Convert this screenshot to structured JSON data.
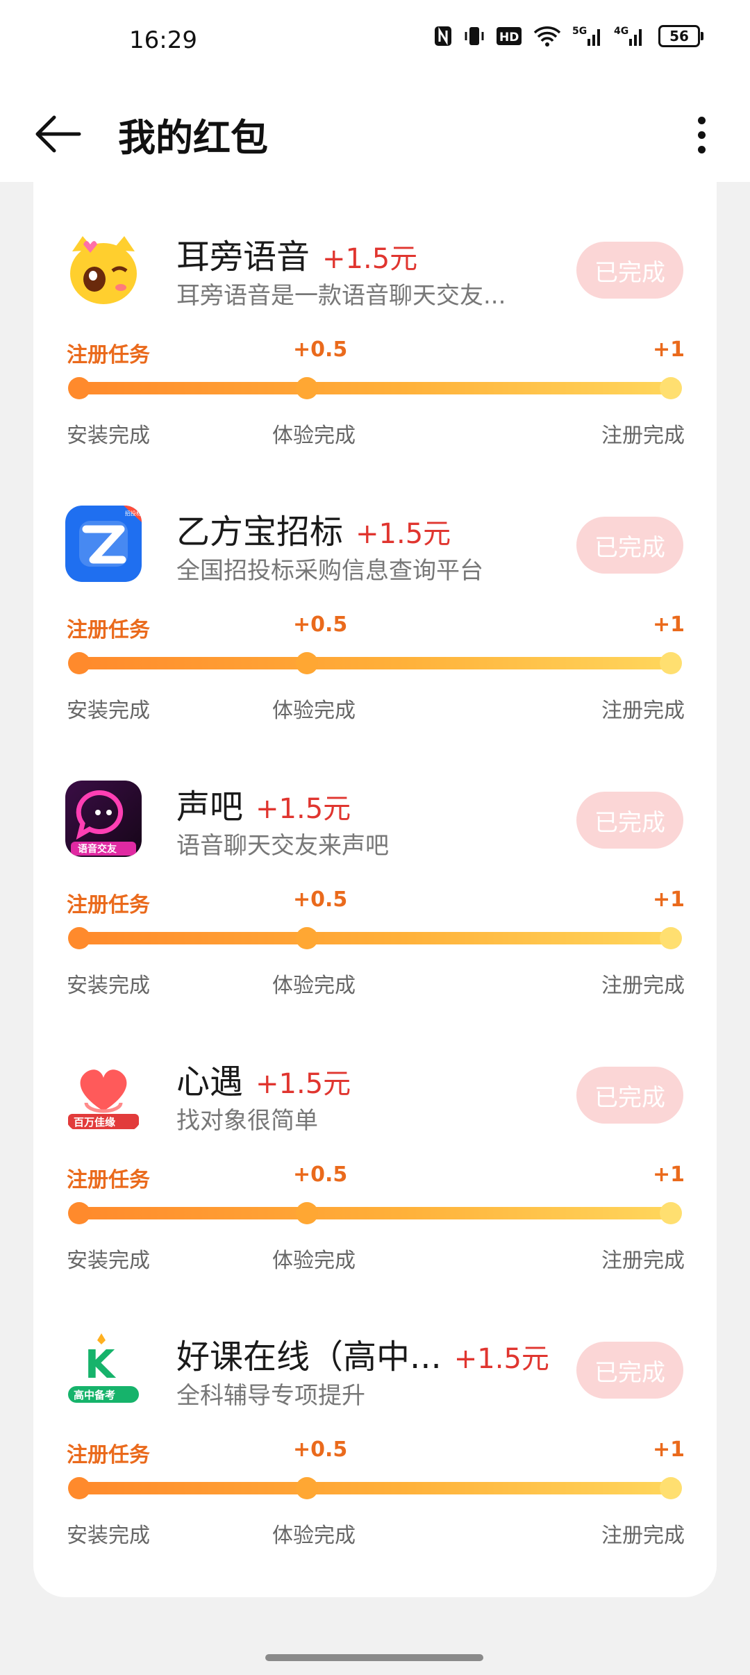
{
  "status": {
    "time": "16:29",
    "battery": "56",
    "hd": "HD",
    "net1": "5G",
    "net2": "4G"
  },
  "header": {
    "title": "我的红包"
  },
  "tasks": [
    {
      "name": "耳旁语音",
      "reward": "+1.5元",
      "desc": "耳旁语音是一款语音聊天交友...",
      "button": "已完成",
      "step_start": "注册任务",
      "step_mid": "+0.5",
      "step_end": "+1",
      "label_start": "安装完成",
      "label_mid": "体验完成",
      "label_end": "注册完成",
      "progress": 1.0,
      "icon": "cartoon-cat-icon",
      "color": "#ffcf2e"
    },
    {
      "name": "乙方宝招标",
      "reward": "+1.5元",
      "desc": "全国招投标采购信息查询平台",
      "button": "已完成",
      "step_start": "注册任务",
      "step_mid": "+0.5",
      "step_end": "+1",
      "label_start": "安装完成",
      "label_mid": "体验完成",
      "label_end": "注册完成",
      "progress": 1.0,
      "icon": "z-logo-icon",
      "color": "#1f6ff0"
    },
    {
      "name": "声吧",
      "reward": "+1.5元",
      "desc": "语音聊天交友来声吧",
      "button": "已完成",
      "step_start": "注册任务",
      "step_mid": "+0.5",
      "step_end": "+1",
      "label_start": "安装完成",
      "label_mid": "体验完成",
      "label_end": "注册完成",
      "progress": 1.0,
      "icon": "chat-bubble-icon",
      "color": "#7a1d6e"
    },
    {
      "name": "心遇",
      "reward": "+1.5元",
      "desc": "找对象很简单",
      "button": "已完成",
      "step_start": "注册任务",
      "step_mid": "+0.5",
      "step_end": "+1",
      "label_start": "安装完成",
      "label_mid": "体验完成",
      "label_end": "注册完成",
      "progress": 1.0,
      "icon": "heart-icon",
      "color": "#ff5a5a"
    },
    {
      "name": "好课在线（高中...",
      "reward": "+1.5元",
      "desc": "全科辅导专项提升",
      "button": "已完成",
      "step_start": "注册任务",
      "step_mid": "+0.5",
      "step_end": "+1",
      "label_start": "安装完成",
      "label_mid": "体验完成",
      "label_end": "注册完成",
      "progress": 1.0,
      "icon": "k-logo-icon",
      "color": "#16b36b"
    }
  ],
  "icon_texts": {
    "t2_badge": "招投标",
    "t3_caption": "语音交友",
    "t4_caption": "百万佳缘",
    "t5_caption": "高中备考",
    "t5_letter": "K",
    "t2_letter": "Z"
  }
}
